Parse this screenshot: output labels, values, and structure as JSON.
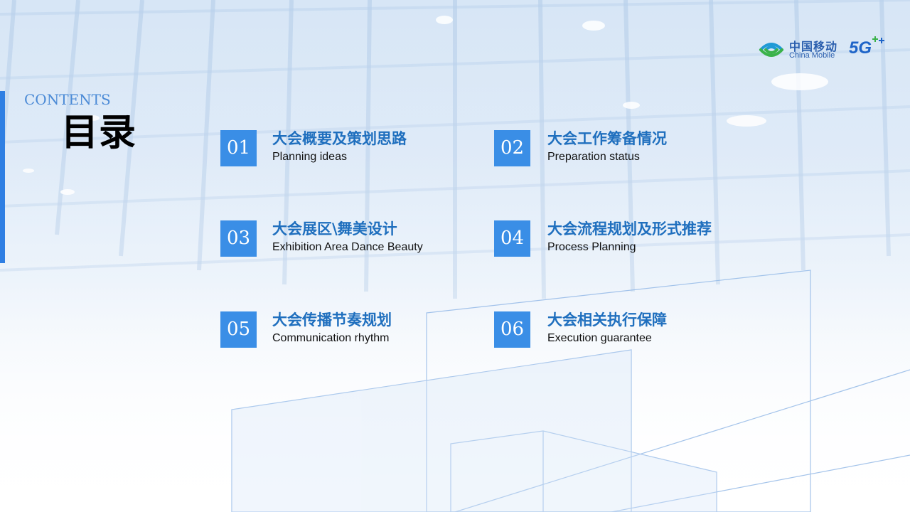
{
  "header": {
    "contents_en": "CONTENTS",
    "contents_cn": "目录"
  },
  "logo": {
    "name_cn": "中国移动",
    "name_en": "China Mobile",
    "badge": "5G"
  },
  "items": [
    {
      "number": "01",
      "title_cn": "大会概要及策划思路",
      "title_en": "Planning ideas"
    },
    {
      "number": "02",
      "title_cn": "大会工作筹备情况",
      "title_en": "Preparation status"
    },
    {
      "number": "03",
      "title_cn": "大会展区\\舞美设计",
      "title_en": "Exhibition Area Dance Beauty"
    },
    {
      "number": "04",
      "title_cn": "大会流程规划及形式推荐",
      "title_en": "Process Planning"
    },
    {
      "number": "05",
      "title_cn": "大会传播节奏规划",
      "title_en": "Communication rhythm"
    },
    {
      "number": "06",
      "title_cn": "大会相关执行保障",
      "title_en": "Execution guarantee"
    }
  ],
  "colors": {
    "accent": "#3a8ee6",
    "title": "#1f6fbe",
    "brand": "#2b5fae"
  }
}
